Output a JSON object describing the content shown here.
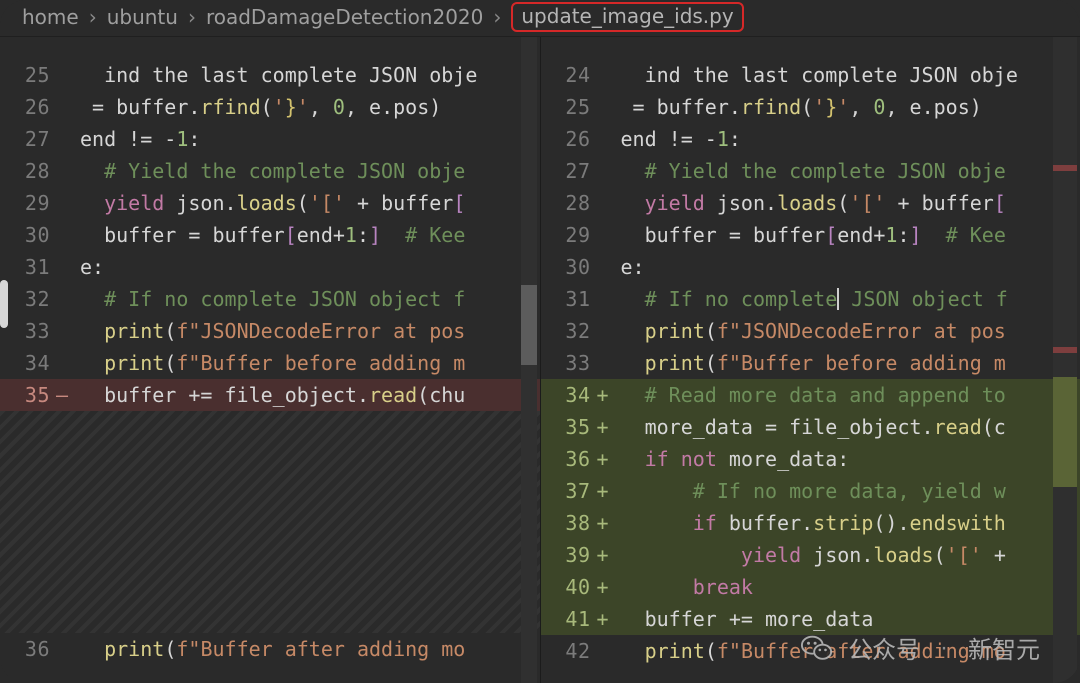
{
  "breadcrumb": {
    "items": [
      "home",
      "ubuntu",
      "roadDamageDetection2020"
    ],
    "file": "update_image_ids.py",
    "sep": "›"
  },
  "left": {
    "lines": [
      {
        "n": "25",
        "m": "",
        "cls": "",
        "seg": [
          [
            "",
            "  ind the last complete JSON obje"
          ]
        ]
      },
      {
        "n": "26",
        "m": "",
        "cls": "",
        "seg": [
          [
            "",
            " = buffer."
          ],
          [
            "tok-func",
            "rfind"
          ],
          [
            "",
            "("
          ],
          [
            "tok-str",
            "'"
          ],
          [
            "tok-brace",
            "}"
          ],
          [
            "tok-str",
            "'"
          ],
          [
            "",
            ", "
          ],
          [
            "tok-num",
            "0"
          ],
          [
            "",
            ", e.pos)"
          ]
        ]
      },
      {
        "n": "27",
        "m": "",
        "cls": "",
        "seg": [
          [
            "",
            "end != -"
          ],
          [
            "tok-num",
            "1"
          ],
          [
            "",
            ":"
          ]
        ]
      },
      {
        "n": "28",
        "m": "",
        "cls": "",
        "seg": [
          [
            "",
            "  "
          ],
          [
            "tok-comment",
            "# Yield the complete JSON obje"
          ]
        ]
      },
      {
        "n": "29",
        "m": "",
        "cls": "",
        "seg": [
          [
            "",
            "  "
          ],
          [
            "tok-keyword",
            "yield"
          ],
          [
            "",
            " json."
          ],
          [
            "tok-func",
            "loads"
          ],
          [
            "",
            "("
          ],
          [
            "tok-str",
            "'['"
          ],
          [
            "",
            " + buffer"
          ],
          [
            "tok-brack",
            "["
          ]
        ]
      },
      {
        "n": "30",
        "m": "",
        "cls": "",
        "seg": [
          [
            "",
            "  buffer = buffer"
          ],
          [
            "tok-brack",
            "["
          ],
          [
            "",
            "end+"
          ],
          [
            "tok-num",
            "1"
          ],
          [
            "",
            ":"
          ],
          [
            "tok-brack",
            "]"
          ],
          [
            "",
            "  "
          ],
          [
            "tok-comment",
            "# Kee"
          ]
        ]
      },
      {
        "n": "31",
        "m": "",
        "cls": "",
        "seg": [
          [
            "",
            "e:"
          ]
        ]
      },
      {
        "n": "32",
        "m": "",
        "cls": "",
        "seg": [
          [
            "",
            "  "
          ],
          [
            "tok-comment",
            "# If no complete JSON object f"
          ]
        ]
      },
      {
        "n": "33",
        "m": "",
        "cls": "",
        "seg": [
          [
            "",
            "  "
          ],
          [
            "tok-func",
            "print"
          ],
          [
            "",
            "("
          ],
          [
            "tok-str",
            "f\"JSONDecodeError at pos"
          ]
        ]
      },
      {
        "n": "34",
        "m": "",
        "cls": "",
        "seg": [
          [
            "",
            "  "
          ],
          [
            "tok-func",
            "print"
          ],
          [
            "",
            "("
          ],
          [
            "tok-str",
            "f\"Buffer before adding m"
          ]
        ]
      },
      {
        "n": "35",
        "m": "—",
        "cls": "removed",
        "seg": [
          [
            "",
            "  buffer += file_object."
          ],
          [
            "tok-func",
            "read"
          ],
          [
            "",
            "(chu"
          ]
        ]
      }
    ],
    "after": [
      {
        "n": "36",
        "m": "",
        "cls": "",
        "seg": [
          [
            "",
            "  "
          ],
          [
            "tok-func",
            "print"
          ],
          [
            "",
            "("
          ],
          [
            "tok-str",
            "f\"Buffer after adding mo"
          ]
        ]
      }
    ]
  },
  "right": {
    "lines": [
      {
        "n": "24",
        "m": "",
        "cls": "",
        "seg": [
          [
            "",
            "  ind the last complete JSON obje"
          ]
        ]
      },
      {
        "n": "25",
        "m": "",
        "cls": "",
        "seg": [
          [
            "",
            " = buffer."
          ],
          [
            "tok-func",
            "rfind"
          ],
          [
            "",
            "("
          ],
          [
            "tok-str",
            "'"
          ],
          [
            "tok-brace",
            "}"
          ],
          [
            "tok-str",
            "'"
          ],
          [
            "",
            ", "
          ],
          [
            "tok-num",
            "0"
          ],
          [
            "",
            ", e.pos)"
          ]
        ]
      },
      {
        "n": "26",
        "m": "",
        "cls": "",
        "seg": [
          [
            "",
            "end != -"
          ],
          [
            "tok-num",
            "1"
          ],
          [
            "",
            ":"
          ]
        ]
      },
      {
        "n": "27",
        "m": "",
        "cls": "",
        "seg": [
          [
            "",
            "  "
          ],
          [
            "tok-comment",
            "# Yield the complete JSON obje"
          ]
        ]
      },
      {
        "n": "28",
        "m": "",
        "cls": "",
        "seg": [
          [
            "",
            "  "
          ],
          [
            "tok-keyword",
            "yield"
          ],
          [
            "",
            " json."
          ],
          [
            "tok-func",
            "loads"
          ],
          [
            "",
            "("
          ],
          [
            "tok-str",
            "'['"
          ],
          [
            "",
            " + buffer"
          ],
          [
            "tok-brack",
            "["
          ]
        ]
      },
      {
        "n": "29",
        "m": "",
        "cls": "",
        "seg": [
          [
            "",
            "  buffer = buffer"
          ],
          [
            "tok-brack",
            "["
          ],
          [
            "",
            "end+"
          ],
          [
            "tok-num",
            "1"
          ],
          [
            "",
            ":"
          ],
          [
            "tok-brack",
            "]"
          ],
          [
            "",
            "  "
          ],
          [
            "tok-comment",
            "# Kee"
          ]
        ]
      },
      {
        "n": "30",
        "m": "",
        "cls": "",
        "seg": [
          [
            "",
            "e:"
          ]
        ]
      },
      {
        "n": "31",
        "m": "",
        "cls": "",
        "seg": [
          [
            "",
            "  "
          ],
          [
            "tok-comment",
            "# If no complete"
          ],
          [
            "cursor",
            ""
          ],
          [
            "tok-comment",
            "JSON object f"
          ]
        ]
      },
      {
        "n": "32",
        "m": "",
        "cls": "",
        "seg": [
          [
            "",
            "  "
          ],
          [
            "tok-func",
            "print"
          ],
          [
            "",
            "("
          ],
          [
            "tok-str",
            "f\"JSONDecodeError at pos"
          ]
        ]
      },
      {
        "n": "33",
        "m": "",
        "cls": "",
        "seg": [
          [
            "",
            "  "
          ],
          [
            "tok-func",
            "print"
          ],
          [
            "",
            "("
          ],
          [
            "tok-str",
            "f\"Buffer before adding m"
          ]
        ]
      },
      {
        "n": "34",
        "m": "+",
        "cls": "added",
        "seg": [
          [
            "",
            "  "
          ],
          [
            "tok-comment",
            "# Read more data and append to"
          ]
        ]
      },
      {
        "n": "35",
        "m": "+",
        "cls": "added",
        "seg": [
          [
            "",
            "  more_data = file_object."
          ],
          [
            "tok-func",
            "read"
          ],
          [
            "",
            "(c"
          ]
        ]
      },
      {
        "n": "36",
        "m": "+",
        "cls": "added",
        "seg": [
          [
            "",
            "  "
          ],
          [
            "tok-keyword",
            "if"
          ],
          [
            "",
            " "
          ],
          [
            "tok-keyword",
            "not"
          ],
          [
            "",
            " more_data:"
          ]
        ]
      },
      {
        "n": "37",
        "m": "+",
        "cls": "added",
        "seg": [
          [
            "",
            "      "
          ],
          [
            "tok-comment",
            "# If no more data, yield w"
          ]
        ]
      },
      {
        "n": "38",
        "m": "+",
        "cls": "added",
        "seg": [
          [
            "",
            "      "
          ],
          [
            "tok-keyword",
            "if"
          ],
          [
            "",
            " buffer."
          ],
          [
            "tok-func",
            "strip"
          ],
          [
            "",
            "()."
          ],
          [
            "tok-func",
            "endswith"
          ]
        ]
      },
      {
        "n": "39",
        "m": "+",
        "cls": "added",
        "seg": [
          [
            "",
            "          "
          ],
          [
            "tok-keyword",
            "yield"
          ],
          [
            "",
            " json."
          ],
          [
            "tok-func",
            "loads"
          ],
          [
            "",
            "("
          ],
          [
            "tok-str",
            "'['"
          ],
          [
            "",
            " +"
          ]
        ]
      },
      {
        "n": "40",
        "m": "+",
        "cls": "added",
        "seg": [
          [
            "",
            "      "
          ],
          [
            "tok-keyword",
            "break"
          ]
        ]
      },
      {
        "n": "41",
        "m": "+",
        "cls": "added",
        "seg": [
          [
            "",
            "  buffer += more_data"
          ]
        ]
      },
      {
        "n": "42",
        "m": "",
        "cls": "",
        "seg": [
          [
            "",
            "  "
          ],
          [
            "tok-func",
            "print"
          ],
          [
            "",
            "("
          ],
          [
            "tok-str",
            "f\"Buffer after adding mo"
          ]
        ]
      }
    ]
  },
  "watermark": {
    "label": "公众号",
    "sep": "·",
    "name": "新智元"
  }
}
